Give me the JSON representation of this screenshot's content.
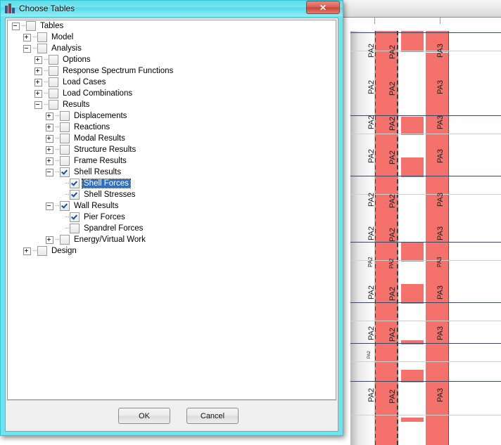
{
  "dialog": {
    "title": "Choose Tables",
    "icon": "app-bars-icon",
    "close_label": "✕",
    "ok_label": "OK",
    "cancel_label": "Cancel",
    "titlebar_color": "#6fe3ee",
    "selection_color": "#2f6fc4"
  },
  "tree": {
    "items": [
      {
        "label": "Tables",
        "depth": 0,
        "expander": "minus",
        "checked": false,
        "selected": false
      },
      {
        "label": "Model",
        "depth": 1,
        "expander": "plus",
        "checked": false,
        "selected": false
      },
      {
        "label": "Analysis",
        "depth": 1,
        "expander": "minus",
        "checked": false,
        "selected": false
      },
      {
        "label": "Options",
        "depth": 2,
        "expander": "plus",
        "checked": false,
        "selected": false
      },
      {
        "label": "Response Spectrum Functions",
        "depth": 2,
        "expander": "plus",
        "checked": false,
        "selected": false
      },
      {
        "label": "Load Cases",
        "depth": 2,
        "expander": "plus",
        "checked": false,
        "selected": false
      },
      {
        "label": "Load Combinations",
        "depth": 2,
        "expander": "plus",
        "checked": false,
        "selected": false
      },
      {
        "label": "Results",
        "depth": 2,
        "expander": "minus",
        "checked": false,
        "selected": false
      },
      {
        "label": "Displacements",
        "depth": 3,
        "expander": "plus",
        "checked": false,
        "selected": false
      },
      {
        "label": "Reactions",
        "depth": 3,
        "expander": "plus",
        "checked": false,
        "selected": false
      },
      {
        "label": "Modal Results",
        "depth": 3,
        "expander": "plus",
        "checked": false,
        "selected": false
      },
      {
        "label": "Structure Results",
        "depth": 3,
        "expander": "plus",
        "checked": false,
        "selected": false
      },
      {
        "label": "Frame Results",
        "depth": 3,
        "expander": "plus",
        "checked": false,
        "selected": false
      },
      {
        "label": "Shell Results",
        "depth": 3,
        "expander": "minus",
        "checked": true,
        "selected": false
      },
      {
        "label": "Shell Forces",
        "depth": 4,
        "expander": "none",
        "checked": true,
        "selected": true
      },
      {
        "label": "Shell Stresses",
        "depth": 4,
        "expander": "none",
        "checked": true,
        "selected": false
      },
      {
        "label": "Wall Results",
        "depth": 3,
        "expander": "minus",
        "checked": true,
        "selected": false
      },
      {
        "label": "Pier Forces",
        "depth": 4,
        "expander": "none",
        "checked": true,
        "selected": false
      },
      {
        "label": "Spandrel Forces",
        "depth": 4,
        "expander": "none",
        "checked": false,
        "selected": false
      },
      {
        "label": "Energy/Virtual Work",
        "depth": 3,
        "expander": "plus",
        "checked": false,
        "selected": false
      },
      {
        "label": "Design",
        "depth": 1,
        "expander": "plus",
        "checked": false,
        "selected": false
      }
    ]
  },
  "background": {
    "pier_color": "#f4726b",
    "labels_left": [
      "PA2",
      "PA2",
      "PA2",
      "PA2",
      "PA2",
      "PA2",
      "PA2",
      "PA2",
      "PA2",
      "PA2",
      "PA2"
    ],
    "labels_mid": [
      "PA2",
      "PA2",
      "PA2",
      "PA2",
      "PA2",
      "PA2",
      "PA2",
      "PA2",
      "PA2",
      "PA2"
    ],
    "labels_right": [
      "PA3",
      "PA3",
      "PA3",
      "PA3",
      "PA3",
      "PA3",
      "PA3",
      "PA3",
      "PA3",
      "PA3"
    ]
  }
}
